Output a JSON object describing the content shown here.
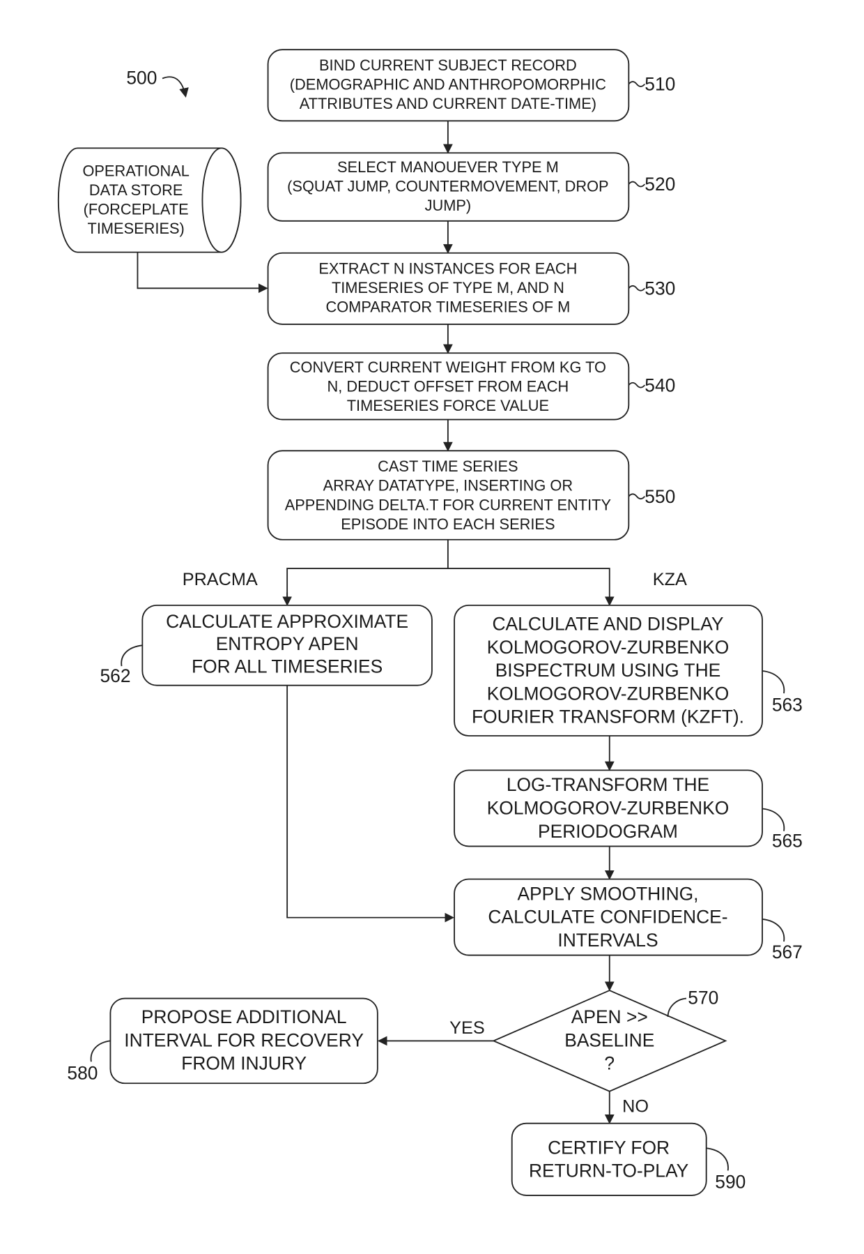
{
  "figure": {
    "ref": "500"
  },
  "nodes": {
    "n510": {
      "ref": "510",
      "lines": [
        "BIND CURRENT SUBJECT RECORD",
        "(DEMOGRAPHIC AND ANTHROPOMORPHIC",
        "ATTRIBUTES AND CURRENT DATE-TIME)"
      ]
    },
    "n520": {
      "ref": "520",
      "lines": [
        "SELECT MANOUEVER TYPE M",
        "(SQUAT JUMP, COUNTERMOVEMENT, DROP",
        "JUMP)"
      ]
    },
    "store": {
      "lines": [
        "OPERATIONAL",
        "DATA STORE",
        "(FORCEPLATE",
        "TIMESERIES)"
      ]
    },
    "n530": {
      "ref": "530",
      "lines": [
        "EXTRACT N INSTANCES FOR EACH",
        "TIMESERIES OF TYPE M, AND N",
        "COMPARATOR TIMESERIES OF M"
      ]
    },
    "n540": {
      "ref": "540",
      "lines": [
        "CONVERT CURRENT WEIGHT FROM KG TO",
        "N, DEDUCT OFFSET FROM EACH",
        "TIMESERIES FORCE VALUE"
      ]
    },
    "n550": {
      "ref": "550",
      "lines": [
        "CAST TIME SERIES",
        "ARRAY DATATYPE, INSERTING OR",
        "APPENDING DELTA.T FOR CURRENT ENTITY",
        "EPISODE INTO EACH SERIES"
      ]
    },
    "n562": {
      "ref": "562",
      "lines": [
        "CALCULATE APPROXIMATE",
        "ENTROPY APEN",
        "FOR ALL TIMESERIES"
      ]
    },
    "n563": {
      "ref": "563",
      "lines": [
        "CALCULATE AND DISPLAY",
        "KOLMOGOROV-ZURBENKO",
        "BISPECTRUM USING THE",
        "KOLMOGOROV-ZURBENKO",
        "FOURIER TRANSFORM (KZFT)."
      ]
    },
    "n565": {
      "ref": "565",
      "lines": [
        "LOG-TRANSFORM THE",
        "KOLMOGOROV-ZURBENKO",
        "PERIODOGRAM"
      ]
    },
    "n567": {
      "ref": "567",
      "lines": [
        "APPLY SMOOTHING,",
        "CALCULATE CONFIDENCE-",
        "INTERVALS"
      ]
    },
    "n570": {
      "ref": "570",
      "lines": [
        "APEN >>",
        "BASELINE",
        "?"
      ]
    },
    "n580": {
      "ref": "580",
      "lines": [
        "PROPOSE ADDITIONAL",
        "INTERVAL FOR RECOVERY",
        "FROM INJURY"
      ]
    },
    "n590": {
      "ref": "590",
      "lines": [
        "CERTIFY FOR",
        "RETURN-TO-PLAY"
      ]
    }
  },
  "edge_labels": {
    "pracma": "PRACMA",
    "kza": "KZA",
    "yes": "YES",
    "no": "NO"
  }
}
